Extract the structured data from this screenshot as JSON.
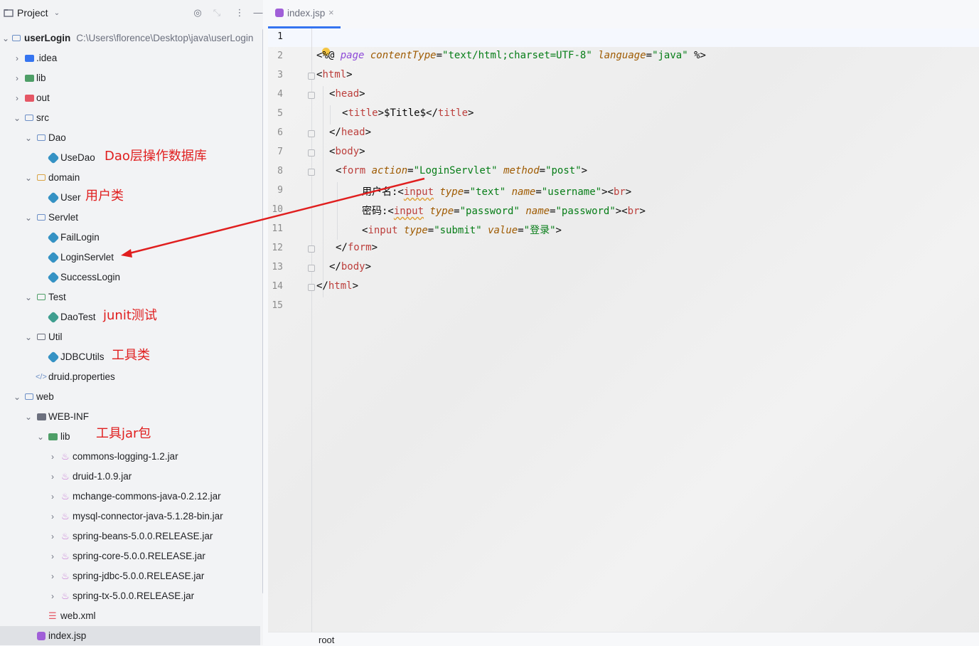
{
  "project_panel": {
    "title": "Project",
    "dropdown_icon": "chevron-down-icon",
    "header_icons": [
      "target-icon",
      "collapse-icon",
      "more-vertical-icon",
      "minimize-icon"
    ],
    "tree": [
      {
        "label": "userLogin",
        "path": "C:\\Users\\florence\\Desktop\\java\\userLogin",
        "icon": "folder-icon"
      },
      {
        "label": ".idea",
        "icon": "idea-folder-icon"
      },
      {
        "label": "lib",
        "icon": "library-folder-icon"
      },
      {
        "label": "out",
        "icon": "output-folder-icon"
      },
      {
        "label": "src",
        "icon": "source-folder-icon"
      },
      {
        "label": "Dao",
        "icon": "package-icon"
      },
      {
        "label": "UseDao",
        "icon": "class-icon"
      },
      {
        "label": "domain",
        "icon": "package-icon"
      },
      {
        "label": "User",
        "icon": "class-icon"
      },
      {
        "label": "Servlet",
        "icon": "package-icon"
      },
      {
        "label": "FailLogin",
        "icon": "class-icon"
      },
      {
        "label": "LoginServlet",
        "icon": "class-icon"
      },
      {
        "label": "SuccessLogin",
        "icon": "class-icon"
      },
      {
        "label": "Test",
        "icon": "test-folder-icon"
      },
      {
        "label": "DaoTest",
        "icon": "test-class-icon"
      },
      {
        "label": "Util",
        "icon": "package-icon"
      },
      {
        "label": "JDBCUtils",
        "icon": "class-icon"
      },
      {
        "label": "druid.properties",
        "icon": "properties-file-icon"
      },
      {
        "label": "web",
        "icon": "web-folder-icon"
      },
      {
        "label": "WEB-INF",
        "icon": "folder-icon"
      },
      {
        "label": "lib",
        "icon": "library-folder-icon"
      },
      {
        "label": "commons-logging-1.2.jar",
        "icon": "jar-icon"
      },
      {
        "label": "druid-1.0.9.jar",
        "icon": "jar-icon"
      },
      {
        "label": "mchange-commons-java-0.2.12.jar",
        "icon": "jar-icon"
      },
      {
        "label": "mysql-connector-java-5.1.28-bin.jar",
        "icon": "jar-icon"
      },
      {
        "label": "spring-beans-5.0.0.RELEASE.jar",
        "icon": "jar-icon"
      },
      {
        "label": "spring-core-5.0.0.RELEASE.jar",
        "icon": "jar-icon"
      },
      {
        "label": "spring-jdbc-5.0.0.RELEASE.jar",
        "icon": "jar-icon"
      },
      {
        "label": "spring-tx-5.0.0.RELEASE.jar",
        "icon": "jar-icon"
      },
      {
        "label": "web.xml",
        "icon": "xml-file-icon"
      },
      {
        "label": "index.jsp",
        "icon": "jsp-file-icon"
      }
    ]
  },
  "annotations": {
    "dao": "Dao层操作数据库",
    "user": "用户类",
    "junit": "junit测试",
    "utils": "工具类",
    "jar": "工具jar包",
    "colors": {
      "annotation": "#e01e1e"
    }
  },
  "editor": {
    "tab": {
      "label": "index.jsp",
      "close": "×",
      "icon": "jsp-file-icon"
    },
    "line_numbers": [
      "1",
      "2",
      "3",
      "4",
      "5",
      "6",
      "7",
      "8",
      "9",
      "10",
      "11",
      "12",
      "13",
      "14",
      "15"
    ],
    "lines": {
      "l2": {
        "a": "<%@ ",
        "b": "page ",
        "c": "contentType",
        "d": "=",
        "e": "\"text/html;charset=UTF-8\"",
        "f": " ",
        "g": "language",
        "h": "=",
        "i": "\"java\"",
        "j": " %>"
      },
      "l3": {
        "a": "<",
        "b": "html",
        "c": ">"
      },
      "l4": {
        "a": "<",
        "b": "head",
        "c": ">"
      },
      "l5": {
        "a": "<",
        "b": "title",
        "c": ">$Title$</",
        "d": "title",
        "e": ">"
      },
      "l6": {
        "a": "</",
        "b": "head",
        "c": ">"
      },
      "l7": {
        "a": "<",
        "b": "body",
        "c": ">"
      },
      "l8": {
        "a": "<",
        "b": "form ",
        "c": "action",
        "d": "=",
        "e": "\"LoginServlet\"",
        "f": " ",
        "g": "method",
        "h": "=",
        "i": "\"post\"",
        "j": ">"
      },
      "l9": {
        "a": "用户名:<",
        "b": "input",
        "c": " ",
        "d": "type",
        "e": "=",
        "f": "\"text\"",
        "g": " ",
        "h": "name",
        "i": "=",
        "j": "\"username\"",
        "k": "><",
        "l": "br",
        "m": ">"
      },
      "l10": {
        "a": "密码:<",
        "b": "input",
        "c": " ",
        "d": "type",
        "e": "=",
        "f": "\"password\"",
        "g": " ",
        "h": "name",
        "i": "=",
        "j": "\"password\"",
        "k": "><",
        "l": "br",
        "m": ">"
      },
      "l11": {
        "a": "<",
        "b": "input",
        "c": " ",
        "d": "type",
        "e": "=",
        "f": "\"submit\"",
        "g": " ",
        "h": "value",
        "i": "=",
        "j": "\"登录\"",
        "k": ">"
      },
      "l12": {
        "a": "</",
        "b": "form",
        "c": ">"
      },
      "l13": {
        "a": "</",
        "b": "body",
        "c": ">"
      },
      "l14": {
        "a": "</",
        "b": "html",
        "c": ">"
      }
    },
    "status": "root",
    "colors": {
      "accent": "#3574f0",
      "tag": "#bc3f3c",
      "attribute": "#7a3e9d",
      "string": "#067d17"
    }
  }
}
